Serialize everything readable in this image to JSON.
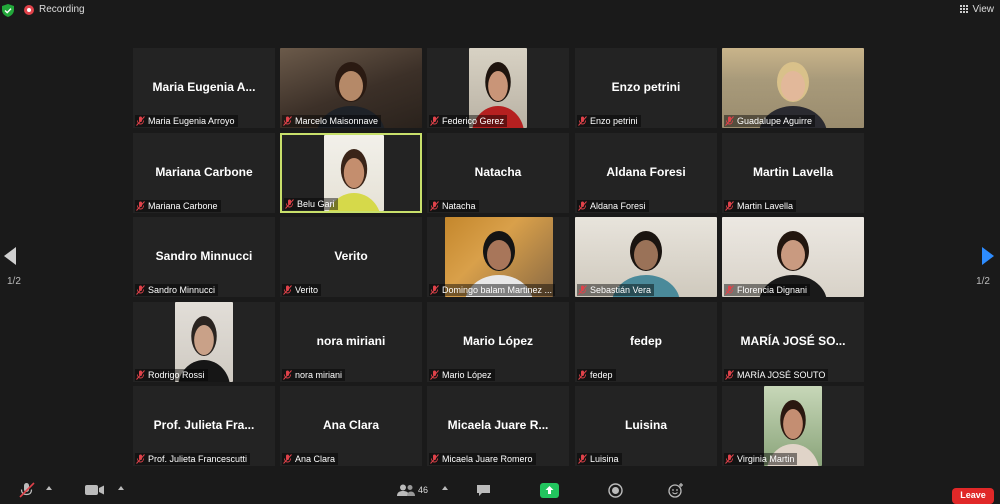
{
  "topbar": {
    "recording_label": "Recording",
    "view_label": "View"
  },
  "pagination": {
    "left": "1/2",
    "right": "1/2"
  },
  "participants": [
    {
      "display": "Maria Eugenia A...",
      "label": "Maria Eugenia Arroyo",
      "video": false
    },
    {
      "display": "",
      "label": "Marcelo Maisonnave",
      "video": true
    },
    {
      "display": "",
      "label": "Federico Gerez",
      "video": true
    },
    {
      "display": "Enzo petrini",
      "label": "Enzo petrini",
      "video": false
    },
    {
      "display": "",
      "label": "Guadalupe Aguirre",
      "video": true
    },
    {
      "display": "Mariana Carbone",
      "label": "Mariana Carbone",
      "video": false
    },
    {
      "display": "",
      "label": "Belu Gari",
      "video": true,
      "active": true
    },
    {
      "display": "Natacha",
      "label": "Natacha",
      "video": false
    },
    {
      "display": "Aldana Foresi",
      "label": "Aldana Foresi",
      "video": false
    },
    {
      "display": "Martin Lavella",
      "label": "Martin Lavella",
      "video": false
    },
    {
      "display": "Sandro Minnucci",
      "label": "Sandro Minnucci",
      "video": false
    },
    {
      "display": "Verito",
      "label": "Verito",
      "video": false
    },
    {
      "display": "",
      "label": "Domingo balam Martinez ...",
      "video": true
    },
    {
      "display": "",
      "label": "Sebastián Vera",
      "video": true
    },
    {
      "display": "",
      "label": "Florencia Dignani",
      "video": true
    },
    {
      "display": "",
      "label": "Rodrigo Rossi",
      "video": true
    },
    {
      "display": "nora miriani",
      "label": "nora miriani",
      "video": false
    },
    {
      "display": "Mario López",
      "label": "Mario López",
      "video": false
    },
    {
      "display": "fedep",
      "label": "fedep",
      "video": false
    },
    {
      "display": "MARÍA JOSÉ SO...",
      "label": "MARÍA JOSÉ SOUTO",
      "video": false
    },
    {
      "display": "Prof. Julieta Fra...",
      "label": "Prof. Julieta Francescutti",
      "video": false
    },
    {
      "display": "Ana Clara",
      "label": "Ana Clara",
      "video": false
    },
    {
      "display": "Micaela Juare R...",
      "label": "Micaela Juare Romero",
      "video": false
    },
    {
      "display": "Luisina",
      "label": "Luisina",
      "video": false
    },
    {
      "display": "",
      "label": "Virginia Martin",
      "video": true
    }
  ],
  "toolbar": {
    "participants_count": "46",
    "leave_label": "Leave"
  },
  "colors": {
    "active_border": "#c8e06b",
    "muted_mic": "#e0424a",
    "leave": "#e02828",
    "nav_arrow": "#2d8cff"
  }
}
